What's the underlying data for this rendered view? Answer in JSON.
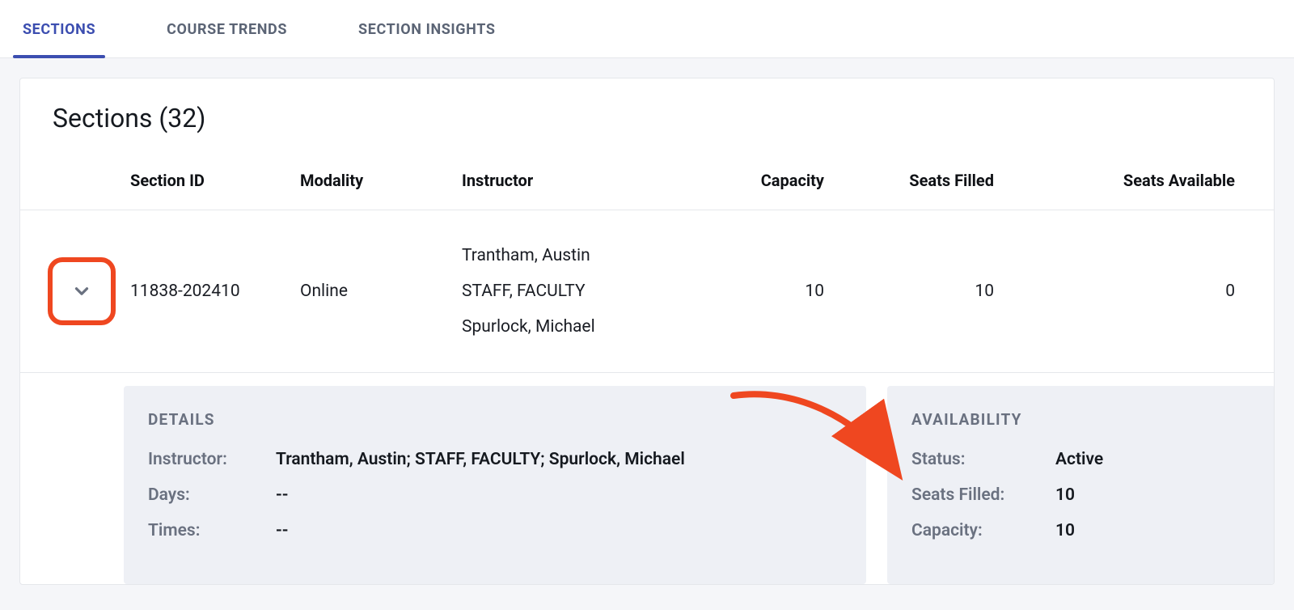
{
  "tabs": {
    "sections": "SECTIONS",
    "course_trends": "COURSE TRENDS",
    "section_insights": "SECTION INSIGHTS"
  },
  "card": {
    "title": "Sections (32)"
  },
  "columns": {
    "section_id": "Section ID",
    "modality": "Modality",
    "instructor": "Instructor",
    "capacity": "Capacity",
    "seats_filled": "Seats Filled",
    "seats_available": "Seats Available"
  },
  "row": {
    "section_id": "11838-202410",
    "modality": "Online",
    "instructor_lines": {
      "l0": "Trantham, Austin",
      "l1": "STAFF, FACULTY",
      "l2": "Spurlock, Michael"
    },
    "capacity": "10",
    "seats_filled": "10",
    "seats_available": "0"
  },
  "details": {
    "heading": "DETAILS",
    "labels": {
      "instructor": "Instructor:",
      "days": "Days:",
      "times": "Times:"
    },
    "values": {
      "instructor": "Trantham, Austin; STAFF, FACULTY; Spurlock, Michael",
      "days": "--",
      "times": "--"
    }
  },
  "availability": {
    "heading": "AVAILABILITY",
    "labels": {
      "status": "Status:",
      "seats_filled": "Seats Filled:",
      "capacity": "Capacity:"
    },
    "values": {
      "status": "Active",
      "seats_filled": "10",
      "capacity": "10"
    }
  }
}
